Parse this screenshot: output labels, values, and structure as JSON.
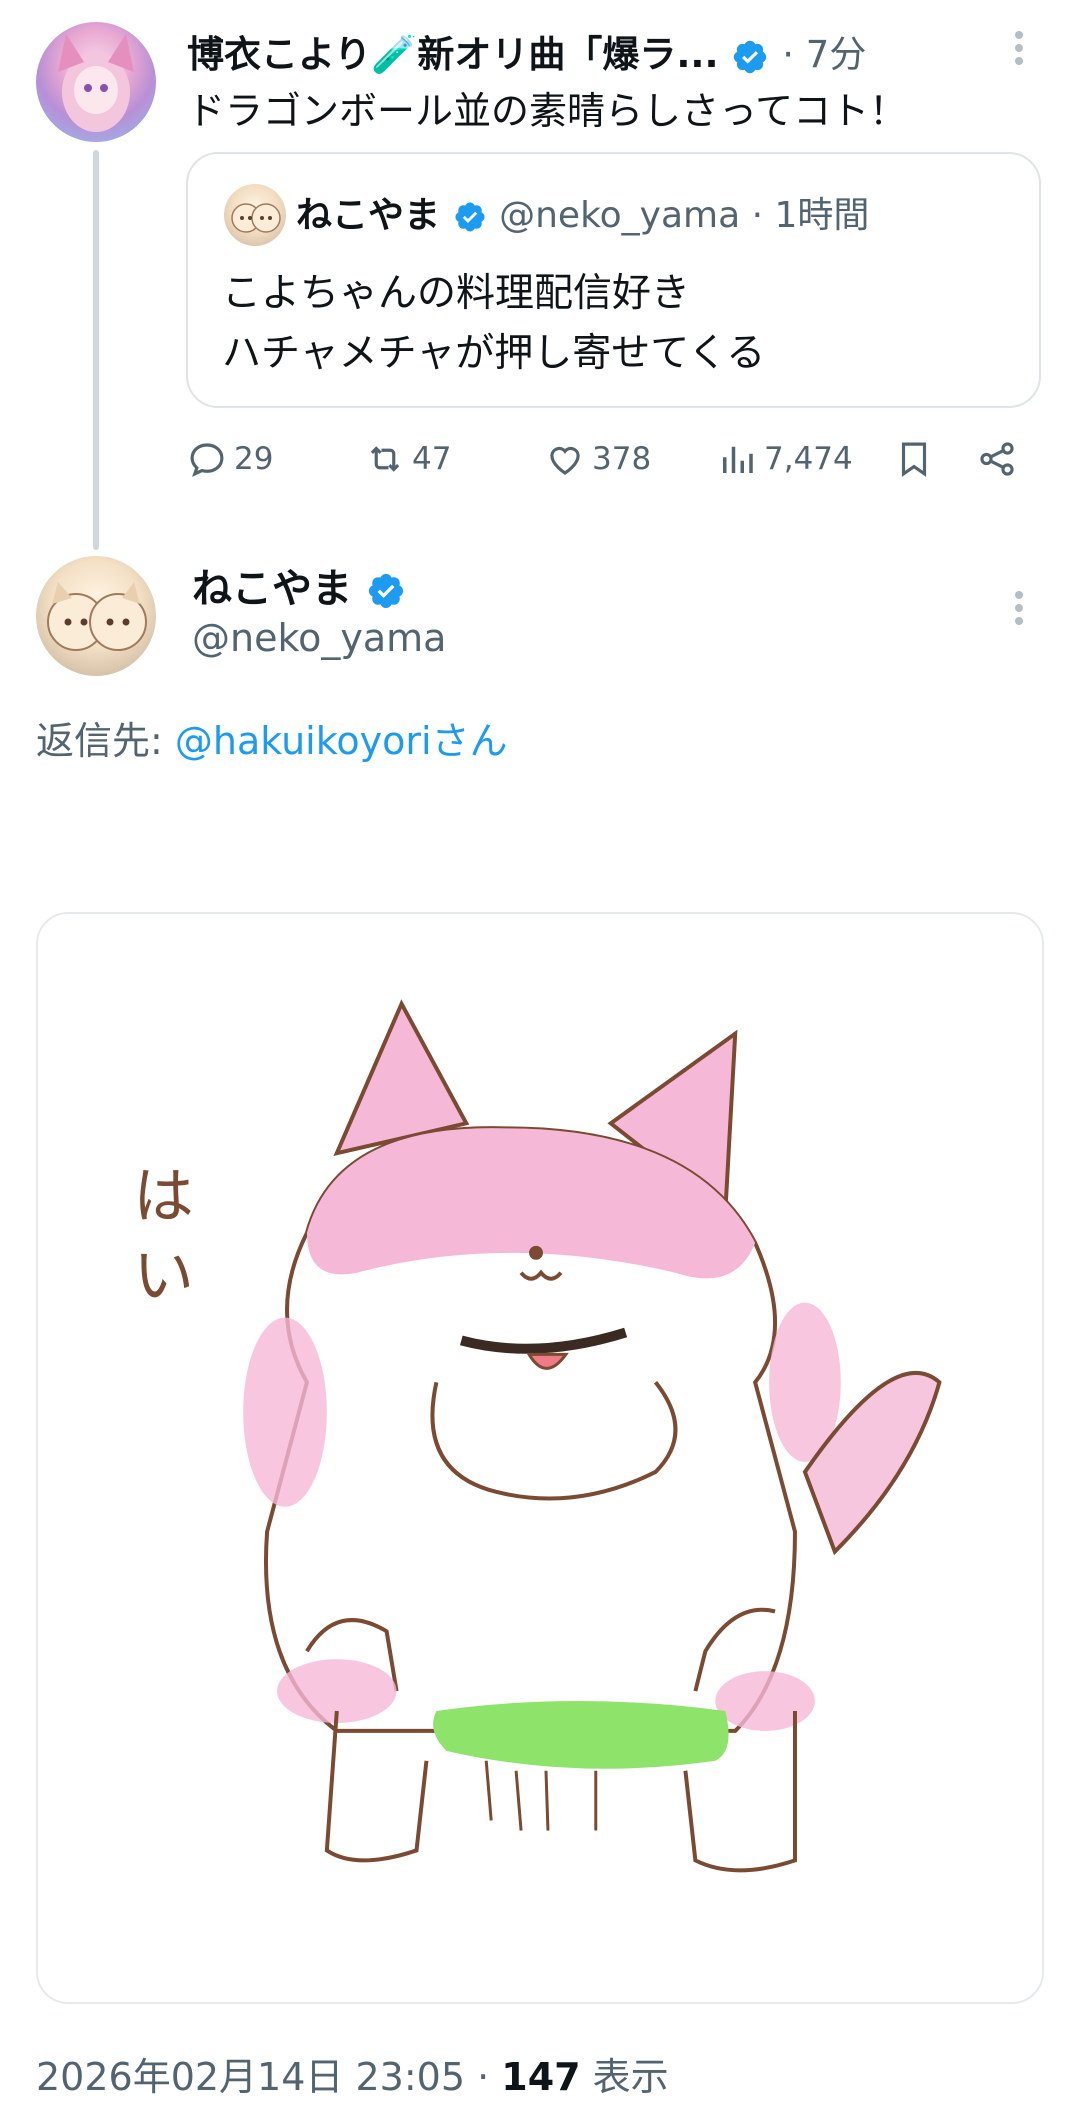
{
  "main_tweet": {
    "author_name": "博衣こより🧪新オリ曲「爆ラ...",
    "time": "· 7分",
    "text": "ドラゴンボール並の素晴らしさってコト！",
    "quote": {
      "author_name": "ねこやま",
      "handle_time": "@neko_yama · 1時間",
      "line1": "こよちゃんの料理配信好き",
      "line2": "ハチャメチャが押し寄せてくる"
    },
    "actions": {
      "replies": "29",
      "retweets": "47",
      "likes": "378",
      "views": "7,474"
    }
  },
  "reply_tweet": {
    "author_name": "ねこやま",
    "handle": "@neko_yama",
    "reply_prefix": "返信先: ",
    "reply_target": "@hakuikoyoriさん",
    "illustration_text": "はい",
    "timestamp": "2026年02月14日 23:05 · ",
    "views_count": "147",
    "views_label": " 表示"
  },
  "colors": {
    "accent": "#1d9bf0",
    "secondary_text": "#536471",
    "pink": "#f6b8d7",
    "green": "#8ee36a",
    "brown": "#7a4a32"
  }
}
